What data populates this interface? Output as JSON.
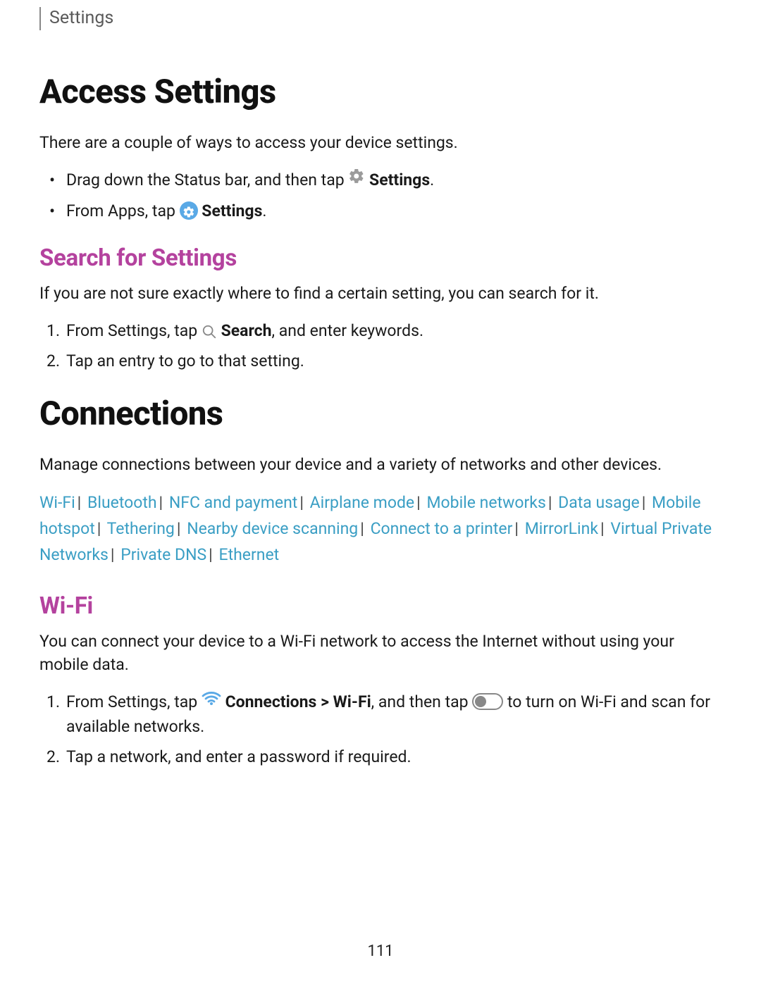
{
  "header": {
    "crumb": "Settings"
  },
  "section1": {
    "title": "Access Settings",
    "intro": "There are a couple of ways to access your device settings.",
    "bullets": {
      "b1_pre": "Drag down the Status bar, and then tap ",
      "b1_bold": "Settings",
      "b1_post": ".",
      "b2_pre": "From Apps, tap ",
      "b2_bold": "Settings",
      "b2_post": "."
    },
    "sub": {
      "title": "Search for Settings",
      "intro": "If you are not sure exactly where to find a certain setting, you can search for it.",
      "s1_pre": "From Settings, tap ",
      "s1_bold": "Search",
      "s1_post": ", and enter keywords.",
      "s2": "Tap an entry to go to that setting."
    }
  },
  "section2": {
    "title": "Connections",
    "intro": "Manage connections between your device and a variety of networks and other devices.",
    "links": [
      "Wi-Fi",
      "Bluetooth",
      "NFC and payment",
      "Airplane mode",
      "Mobile networks",
      "Data usage",
      "Mobile hotspot",
      "Tethering",
      "Nearby device scanning",
      "Connect to a printer",
      "MirrorLink",
      "Virtual Private Networks",
      "Private DNS",
      "Ethernet"
    ],
    "wifi": {
      "title": "Wi-Fi",
      "intro": "You can connect your device to a Wi-Fi network to access the Internet without using your mobile data.",
      "s1_pre": "From Settings, tap ",
      "s1_bold1": "Connections",
      "s1_caret": " > ",
      "s1_bold2": "Wi-Fi",
      "s1_mid": ", and then tap ",
      "s1_post": " to turn on Wi-Fi and scan for available networks.",
      "s2": "Tap a network, and enter a password if required."
    }
  },
  "page_number": "111"
}
